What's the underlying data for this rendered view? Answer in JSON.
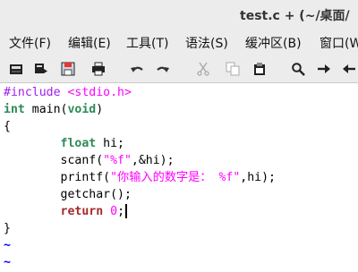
{
  "window": {
    "title": "test.c + (~/桌面/"
  },
  "menu": [
    {
      "label": "文件(F)"
    },
    {
      "label": "编辑(E)"
    },
    {
      "label": "工具(T)"
    },
    {
      "label": "语法(S)"
    },
    {
      "label": "缓冲区(B)"
    },
    {
      "label": "窗口(W"
    }
  ],
  "toolbar": [
    {
      "icon": "open-icon"
    },
    {
      "icon": "load-session-icon"
    },
    {
      "icon": "save-icon"
    },
    {
      "icon": "print-icon"
    },
    {
      "icon": "undo-icon"
    },
    {
      "icon": "redo-icon"
    },
    {
      "icon": "cut-icon"
    },
    {
      "icon": "copy-icon"
    },
    {
      "icon": "paste-icon"
    },
    {
      "icon": "find-icon"
    },
    {
      "icon": "find-next-icon"
    },
    {
      "icon": "find-prev-icon"
    }
  ],
  "code": {
    "l1_kw": "#include ",
    "l1_hdr": "<stdio.h>",
    "l2_type": "int",
    "l2_rest": " main(",
    "l2_void": "void",
    "l2_close": ")",
    "l3": "{",
    "l4_indent": "        ",
    "l4_type": "float",
    "l4_rest": " hi;",
    "l5_a": "        scanf(",
    "l5_str": "\"%f\"",
    "l5_b": ",&hi);",
    "l6_a": "        printf(",
    "l6_str": "\"你输入的数字是： %f\"",
    "l6_b": ",hi);",
    "l7": "        getchar();",
    "l8_indent": "        ",
    "l8_kw": "return",
    "l8_sp": " ",
    "l8_num": "0",
    "l8_end": ";",
    "l9": "}",
    "tilde": "~"
  }
}
